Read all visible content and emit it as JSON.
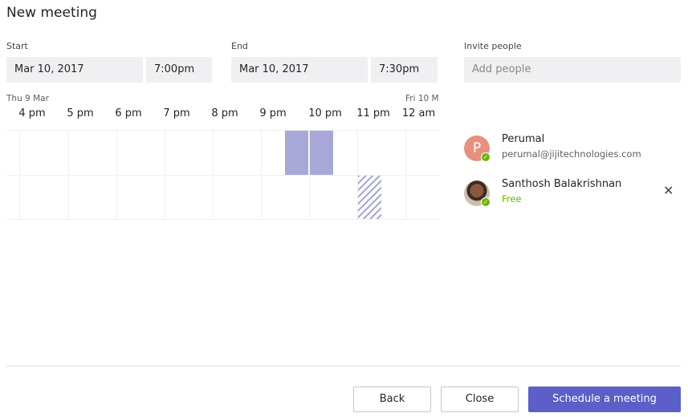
{
  "title": "New meeting",
  "start": {
    "label": "Start",
    "date": "Mar 10, 2017",
    "time": "7:00pm"
  },
  "end": {
    "label": "End",
    "date": "Mar 10, 2017",
    "time": "7:30pm"
  },
  "invite": {
    "label": "Invite people",
    "placeholder": "Add people"
  },
  "scheduler": {
    "day_start": "Thu 9 Mar",
    "day_end": "Fri 10 M",
    "hours": [
      "4 pm",
      "5 pm",
      "6 pm",
      "7 pm",
      "8 pm",
      "9 pm",
      "10 pm",
      "11 pm",
      "12 am"
    ]
  },
  "people": [
    {
      "initial": "P",
      "name": "Perumal",
      "detail": "perumal@jijitechnologies.com"
    },
    {
      "name": "Santhosh Balakrishnan",
      "detail": "Free"
    }
  ],
  "icons": {
    "status": "check-icon",
    "remove": "close-icon"
  },
  "colors": {
    "accent": "#5b5fc7",
    "busy": "#a8a8d8",
    "available": "#6bb700",
    "avatar_p": "#e8907f"
  },
  "buttons": {
    "back": "Back",
    "close": "Close",
    "schedule": "Schedule a meeting"
  }
}
